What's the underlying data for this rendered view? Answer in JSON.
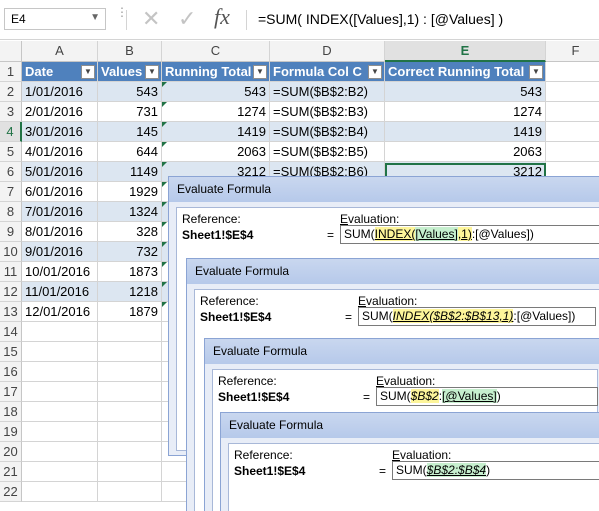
{
  "formula_bar": {
    "name_box": "E4",
    "formula": "=SUM( INDEX([Values],1) : [@Values] )"
  },
  "columns": [
    "A",
    "B",
    "C",
    "D",
    "E",
    "F"
  ],
  "rows": [
    "1",
    "2",
    "3",
    "4",
    "5",
    "6",
    "7",
    "8",
    "9",
    "10",
    "11",
    "12",
    "13",
    "14",
    "15",
    "16",
    "17",
    "18",
    "19",
    "20",
    "21",
    "22"
  ],
  "table": {
    "headers": [
      "Date",
      "Values",
      "Running Total",
      "Formula Col C",
      "Correct Running Total"
    ],
    "data": [
      [
        "1/01/2016",
        "543",
        "543",
        "=SUM($B$2:B2)",
        "543"
      ],
      [
        "2/01/2016",
        "731",
        "1274",
        "=SUM($B$2:B3)",
        "1274"
      ],
      [
        "3/01/2016",
        "145",
        "1419",
        "=SUM($B$2:B4)",
        "1419"
      ],
      [
        "4/01/2016",
        "644",
        "2063",
        "=SUM($B$2:B5)",
        "2063"
      ],
      [
        "5/01/2016",
        "1149",
        "3212",
        "=SUM($B$2:B6)",
        "3212"
      ],
      [
        "6/01/2016",
        "1929",
        "",
        "",
        ""
      ],
      [
        "7/01/2016",
        "1324",
        "",
        "",
        ""
      ],
      [
        "8/01/2016",
        "328",
        "",
        "",
        ""
      ],
      [
        "9/01/2016",
        "732",
        "",
        "",
        ""
      ],
      [
        "10/01/2016",
        "1873",
        "",
        "",
        ""
      ],
      [
        "11/01/2016",
        "1218",
        "",
        "",
        ""
      ],
      [
        "12/01/2016",
        "1879",
        "",
        "",
        ""
      ]
    ]
  },
  "dialog": {
    "title": "Evaluate Formula",
    "reference_label": "Reference:",
    "evaluation_label": "Evaluation:",
    "reference": "Sheet1!$E$4",
    "equals": "=",
    "steps": [
      {
        "pre": "SUM(",
        "hl": "INDEX([Values],1)",
        "post": ":[@Values])"
      },
      {
        "pre": "SUM(",
        "hl": "INDEX($B$2:$B$13,1)",
        "post": ":[@Values])"
      },
      {
        "pre": "SUM(",
        "hl": "$B$2",
        "mid": ":",
        "hl2": "[@Values]",
        "post": ")"
      },
      {
        "pre": "SUM(",
        "hl": "$B$2:$B$4",
        "post": ")"
      }
    ]
  },
  "colors": {
    "header": "#4f81bd",
    "band": "#dce6f1",
    "accent": "#217346"
  }
}
